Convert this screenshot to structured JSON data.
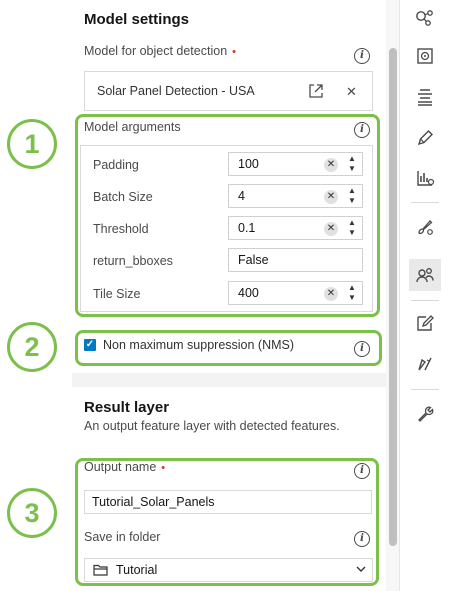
{
  "model_settings": {
    "title": "Model settings",
    "model_label": "Model for object detection",
    "required_marker": "•",
    "model_value": "Solar Panel Detection - USA"
  },
  "model_arguments": {
    "label": "Model arguments",
    "args": [
      {
        "name": "Padding",
        "value": "100",
        "numeric": true
      },
      {
        "name": "Batch Size",
        "value": "4",
        "numeric": true
      },
      {
        "name": "Threshold",
        "value": "0.1",
        "numeric": true
      },
      {
        "name": "return_bboxes",
        "value": "False",
        "numeric": false
      },
      {
        "name": "Tile Size",
        "value": "400",
        "numeric": true
      }
    ]
  },
  "nms": {
    "label": "Non maximum suppression (NMS)",
    "checked": true
  },
  "result_layer": {
    "title": "Result layer",
    "description": "An output feature layer with detected features.",
    "output_name_label": "Output name",
    "output_name_value": "Tutorial_Solar_Panels",
    "folder_label": "Save in folder",
    "folder_value": "Tutorial"
  },
  "callouts": [
    "1",
    "2",
    "3"
  ],
  "icons": {
    "info": "i",
    "clear": "✕",
    "step_up": "▲",
    "step_down": "▼",
    "check": "✓"
  },
  "colors": {
    "callout_green": "#7cc04b",
    "checkbox_blue": "#007ac2",
    "required_red": "#d83020"
  }
}
